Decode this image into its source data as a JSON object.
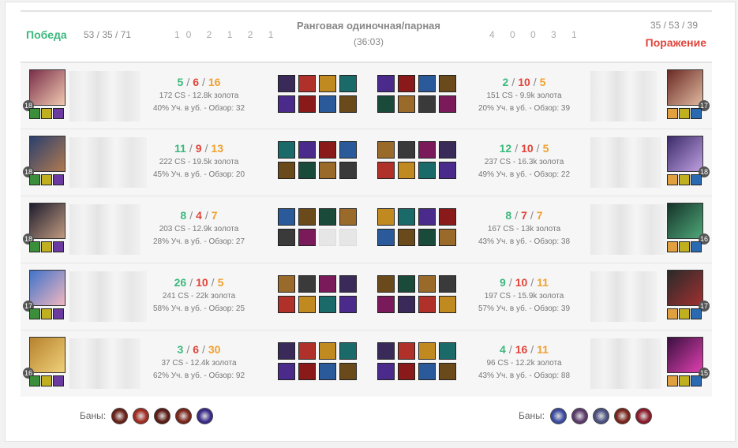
{
  "header": {
    "win_label": "Победа",
    "loss_label": "Поражение",
    "win_kda": "53 / 35 / 71",
    "loss_kda": "35 / 53 / 39",
    "win_objectives": "10 2 1 2 1",
    "loss_objectives": "4 0 0 3 1",
    "queue": "Ранговая одиночная/парная",
    "duration": "(36:03)"
  },
  "colors": {
    "win": "#3bb97c",
    "loss": "#e0453a",
    "assists": "#f0a030"
  },
  "blue": [
    {
      "level": "18",
      "k": "5",
      "d": "6",
      "a": "16",
      "cs": "172 CS - 12.8k золота",
      "stats": "40% Уч. в уб. - Обзор: 32",
      "champ": [
        "#7a2f4a",
        "#f0c9b0"
      ]
    },
    {
      "level": "18",
      "k": "11",
      "d": "9",
      "a": "13",
      "cs": "222 CS - 19.5k золота",
      "stats": "45% Уч. в уб. - Обзор: 20",
      "champ": [
        "#2a3f6e",
        "#b07a50"
      ]
    },
    {
      "level": "18",
      "k": "8",
      "d": "4",
      "a": "7",
      "cs": "203 CS - 12.9k золота",
      "stats": "28% Уч. в уб. - Обзор: 27",
      "champ": [
        "#1f1d2e",
        "#c09a80"
      ]
    },
    {
      "level": "17",
      "k": "26",
      "d": "10",
      "a": "5",
      "cs": "241 CS - 22k золота",
      "stats": "58% Уч. в уб. - Обзор: 25",
      "champ": [
        "#3f73c9",
        "#f1b6c0"
      ]
    },
    {
      "level": "16",
      "k": "3",
      "d": "6",
      "a": "30",
      "cs": "37 CS - 12.4k золота",
      "stats": "62% Уч. в уб. - Обзор: 92",
      "champ": [
        "#b7822e",
        "#f0d07a"
      ]
    }
  ],
  "red": [
    {
      "level": "17",
      "k": "2",
      "d": "10",
      "a": "5",
      "cs": "151 CS - 9.9k золота",
      "stats": "20% Уч. в уб. - Обзор: 39",
      "champ": [
        "#6b2a24",
        "#e0b9a0"
      ]
    },
    {
      "level": "18",
      "k": "12",
      "d": "10",
      "a": "5",
      "cs": "237 CS - 16.3k золота",
      "stats": "49% Уч. в уб. - Обзор: 22",
      "champ": [
        "#3b2b6a",
        "#c0a0e0"
      ]
    },
    {
      "level": "16",
      "k": "8",
      "d": "7",
      "a": "7",
      "cs": "167 CS - 13k золота",
      "stats": "43% Уч. в уб. - Обзор: 38",
      "champ": [
        "#16332a",
        "#4ea878"
      ]
    },
    {
      "level": "17",
      "k": "9",
      "d": "10",
      "a": "11",
      "cs": "197 CS - 15.9k золота",
      "stats": "57% Уч. в уб. - Обзор: 39",
      "champ": [
        "#2a2a2a",
        "#a03030"
      ]
    },
    {
      "level": "15",
      "k": "4",
      "d": "16",
      "a": "11",
      "cs": "96 CS - 12.2k золота",
      "stats": "43% Уч. в уб. - Обзор: 88",
      "champ": [
        "#3a1040",
        "#e040b0"
      ]
    }
  ],
  "bans": {
    "label": "Баны:",
    "blue": [
      "#6a2018",
      "#a02a20",
      "#5a1a14",
      "#7a2418",
      "#3a2a8a"
    ],
    "red": [
      "#3a4aa0",
      "#5a3a6a",
      "#4a5080",
      "#7a2418",
      "#8a1a2a"
    ]
  }
}
